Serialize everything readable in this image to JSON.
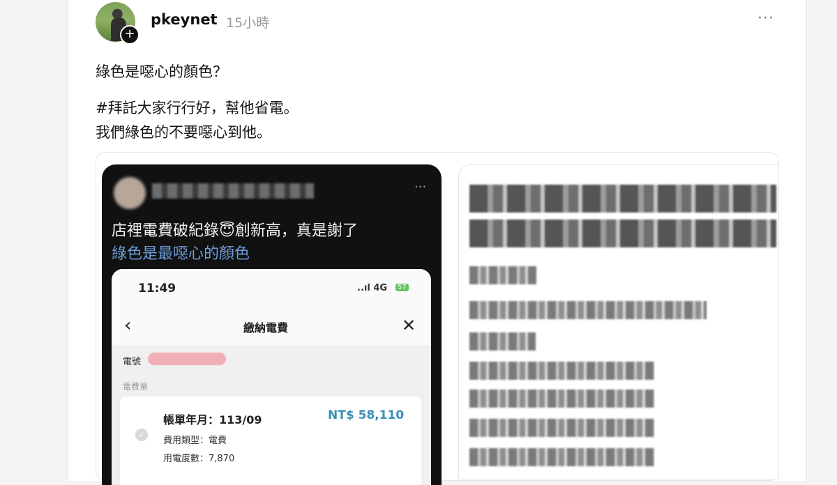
{
  "post": {
    "username": "pkeynet",
    "time": "15小時",
    "more_icon": "···",
    "line1": "綠色是噁心的顏色？",
    "line2": "#拜託大家行行好，幫他省電。",
    "line3": "我們綠色的不要噁心到他。"
  },
  "embedded_left": {
    "more_icon": "···",
    "caption_line1": "店裡電費破紀錄😇創新高，真是謝了",
    "caption_line2": "綠色是最噁心的顏色",
    "phone": {
      "clock": "11:49",
      "signal": "..ıl 4G",
      "battery": "57",
      "back_icon": "‹",
      "title": "繳納電費",
      "close_icon": "✕",
      "label_account": "電號",
      "label_bills": "電費單",
      "bill_month": "帳單年月：113/09",
      "bill_amount": "NT$ 58,110",
      "bill_type": "費用類型：電費",
      "bill_usage": "用電度數：7,870"
    }
  },
  "colors": {
    "link_blue": "#6c9bd9",
    "amount_blue": "#3b8fb8",
    "battery_green": "#62c462"
  }
}
